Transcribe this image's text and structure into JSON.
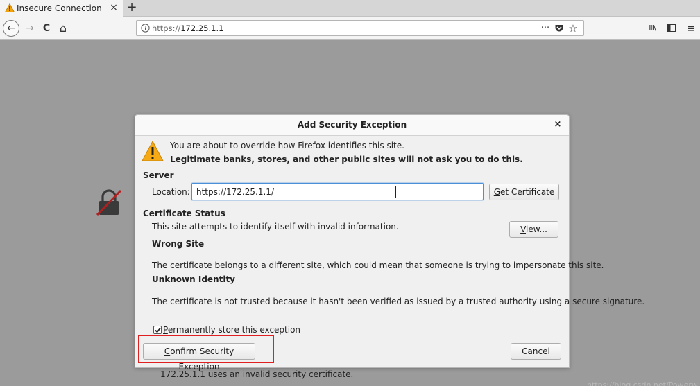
{
  "tab": {
    "title": "Insecure Connection",
    "close": "×"
  },
  "new_tab": "+",
  "nav": {
    "back": "←",
    "forward": "→",
    "reload": "C",
    "home": "⌂"
  },
  "url": {
    "scheme": "https://",
    "host": "172.25.1.1",
    "page_actions": "···",
    "pocket": "▼",
    "bookmark": "☆"
  },
  "tools": {
    "library": "III\\",
    "sidebar": "⊡",
    "menu": "≡"
  },
  "dialog": {
    "title": "Add Security Exception",
    "close": "×",
    "intro_line1": "You are about to override how Firefox identifies this site.",
    "intro_line2": "Legitimate banks, stores, and other public sites will not ask you to do this.",
    "server_label": "Server",
    "location_label": "Location:",
    "location_value": "https://172.25.1.1/",
    "get_certificate_prefix": "",
    "get_certificate_key": "G",
    "get_certificate_rest": "et Certificate",
    "cert_status_label": "Certificate Status",
    "cert_status_text": "This site attempts to identify itself with invalid information.",
    "view_key": "V",
    "view_rest": "iew...",
    "wrong_site_head": "Wrong Site",
    "wrong_site_text": "The certificate belongs to a different site, which could mean that someone is trying to impersonate this site.",
    "unknown_identity_head": "Unknown Identity",
    "unknown_identity_text": "The certificate is not trusted because it hasn't been verified as issued by a trusted authority using a secure signature.",
    "permanent_key": "P",
    "permanent_rest": "ermanently store this exception",
    "permanent_checked": true,
    "confirm_key": "C",
    "confirm_rest": "onfirm Security Exception",
    "cancel_label": "Cancel"
  },
  "background_text": "172.25.1.1 uses an invalid security certificate.",
  "watermark": "https://blog.csdn.net/Powerw",
  "colors": {
    "highlight": "#e02020",
    "focus": "#4a90d9",
    "warning": "#f0a30a"
  }
}
